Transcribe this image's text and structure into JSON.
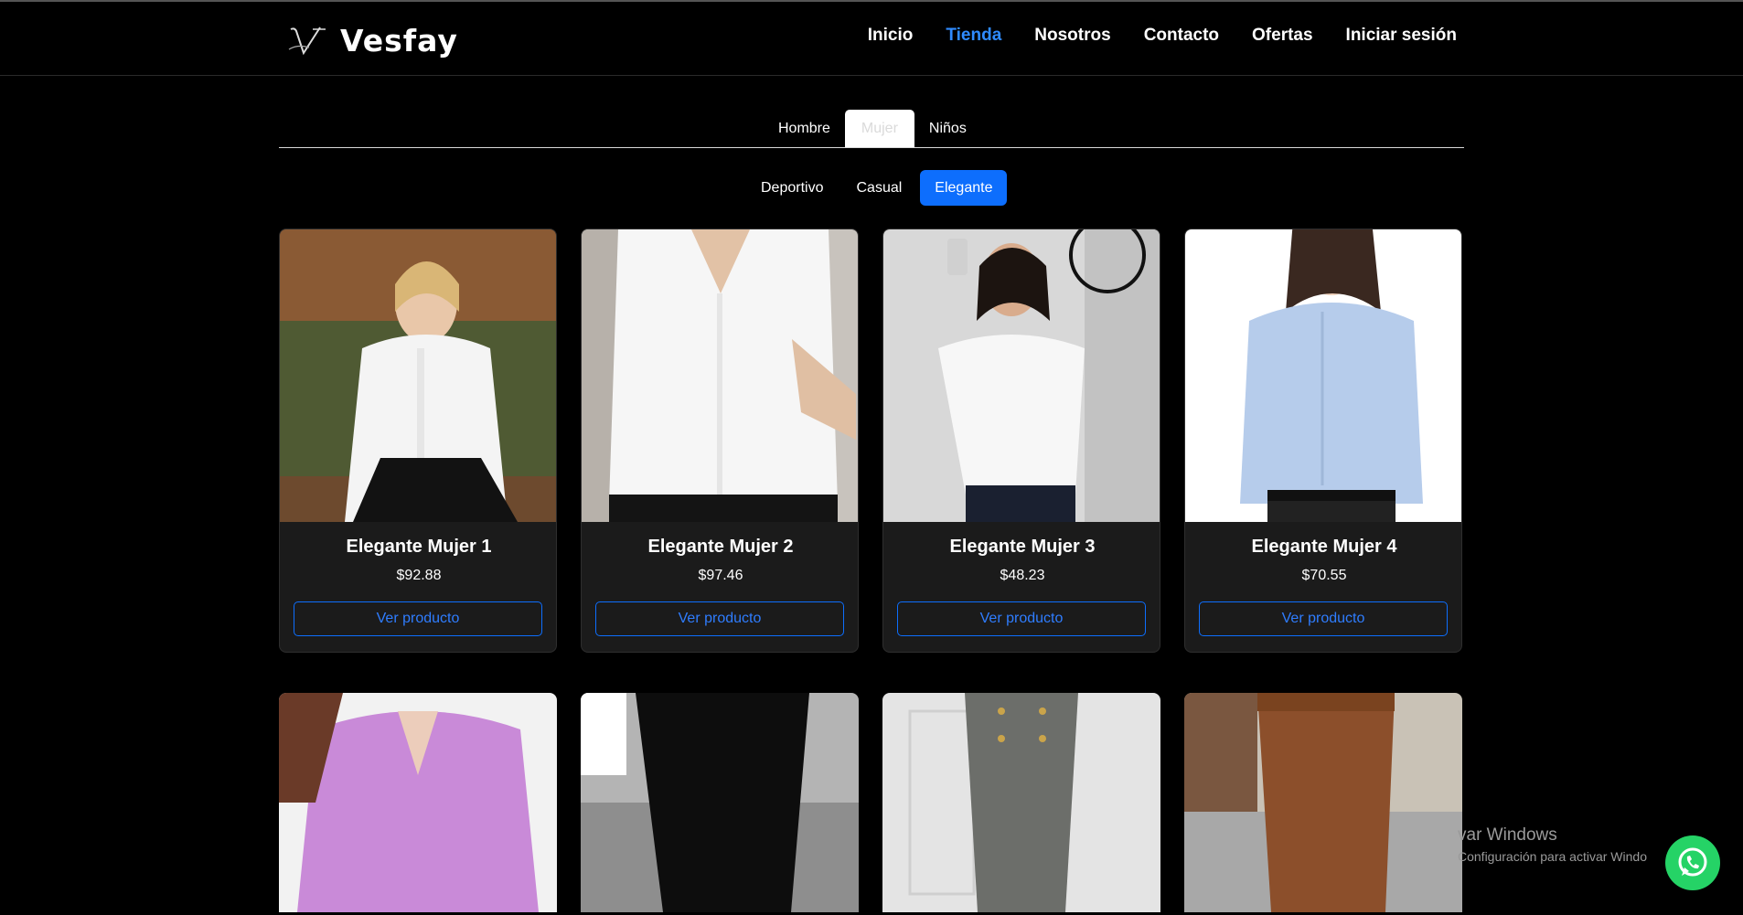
{
  "header": {
    "brand_name": "Vesfay",
    "nav": [
      {
        "label": "Inicio",
        "active": false
      },
      {
        "label": "Tienda",
        "active": true
      },
      {
        "label": "Nosotros",
        "active": false
      },
      {
        "label": "Contacto",
        "active": false
      },
      {
        "label": "Ofertas",
        "active": false
      },
      {
        "label": "Iniciar sesión",
        "active": false
      }
    ]
  },
  "gender_tabs": [
    "Hombre",
    "Mujer",
    "Niños"
  ],
  "gender_active": "Mujer",
  "style_pills": [
    "Deportivo",
    "Casual",
    "Elegante"
  ],
  "style_active": "Elegante",
  "products": [
    {
      "title": "Elegante Mujer 1",
      "price": "$92.88",
      "button": "Ver producto"
    },
    {
      "title": "Elegante Mujer 2",
      "price": "$97.46",
      "button": "Ver producto"
    },
    {
      "title": "Elegante Mujer 3",
      "price": "$48.23",
      "button": "Ver producto"
    },
    {
      "title": "Elegante Mujer 4",
      "price": "$70.55",
      "button": "Ver producto"
    }
  ],
  "overlay": {
    "watermark_line1": "var Windows",
    "watermark_line2": "Configuración para activar Windo"
  },
  "colors": {
    "accent": "#0d6efd",
    "nav_active": "#2f8bff",
    "background": "#000000",
    "card": "#1b1b1b",
    "whatsapp": "#25d366"
  }
}
